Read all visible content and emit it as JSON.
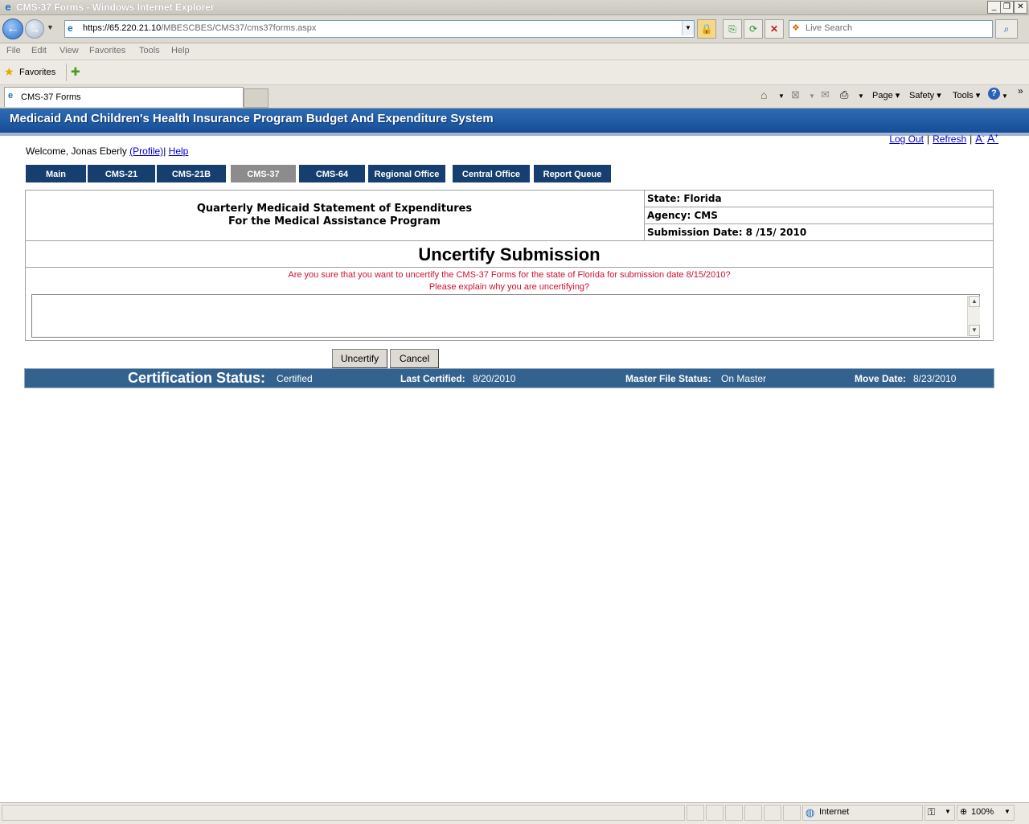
{
  "window": {
    "title": "CMS-37 Forms - Windows Internet Explorer"
  },
  "address": {
    "scheme_host": "https://65.220.21.10",
    "path": "/MBESCBES/CMS37/cms37forms.aspx"
  },
  "search": {
    "placeholder": "Live Search"
  },
  "menu": [
    "File",
    "Edit",
    "View",
    "Favorites",
    "Tools",
    "Help"
  ],
  "favorites": {
    "label": "Favorites"
  },
  "browser_tab": {
    "label": "CMS-37 Forms"
  },
  "toolbar": {
    "page": "Page",
    "safety": "Safety",
    "tools": "Tools"
  },
  "banner": {
    "title": "Medicaid And Children's Health Insurance Program Budget And Expenditure System"
  },
  "toplinks": {
    "logout": "Log Out",
    "refresh": "Refresh"
  },
  "welcome": {
    "text": "Welcome, Jonas Eberly ",
    "profile": "(Profile)",
    "sep": "|",
    "help": "Help"
  },
  "nav_tabs": [
    "Main",
    "CMS-21",
    "CMS-21B",
    "CMS-37",
    "CMS-64",
    "Regional Office",
    "Central Office",
    "Report Queue"
  ],
  "header": {
    "line1": "Quarterly Medicaid Statement of Expenditures",
    "line2": "For the Medical Assistance Program",
    "state": "State: Florida",
    "agency": "Agency: CMS",
    "submission_date": "Submission Date: 8 /15/ 2010"
  },
  "uncertify": {
    "title": "Uncertify Submission",
    "question": "Are you sure that you want to uncertify the CMS-37 Forms for the state of Florida for submission date 8/15/2010?",
    "prompt": "Please explain why you are uncertifying?",
    "reason_value": ""
  },
  "buttons": {
    "uncertify": "Uncertify",
    "cancel": "Cancel"
  },
  "status": {
    "cert_label": "Certification Status:",
    "cert_value": "Certified",
    "last_label": "Last Certified:",
    "last_value": "8/20/2010",
    "master_label": "Master File Status:",
    "master_value": "On Master",
    "move_label": "Move Date:",
    "move_value": "8/23/2010"
  },
  "ie_status": {
    "zone": "Internet",
    "zoom": "100%"
  },
  "colors": {
    "banner": "#1f5aa0",
    "nav_tab": "#163f70",
    "nav_tab_active": "#8c8c8c",
    "warning_text": "#d0102d",
    "status_bar": "#33628f"
  }
}
